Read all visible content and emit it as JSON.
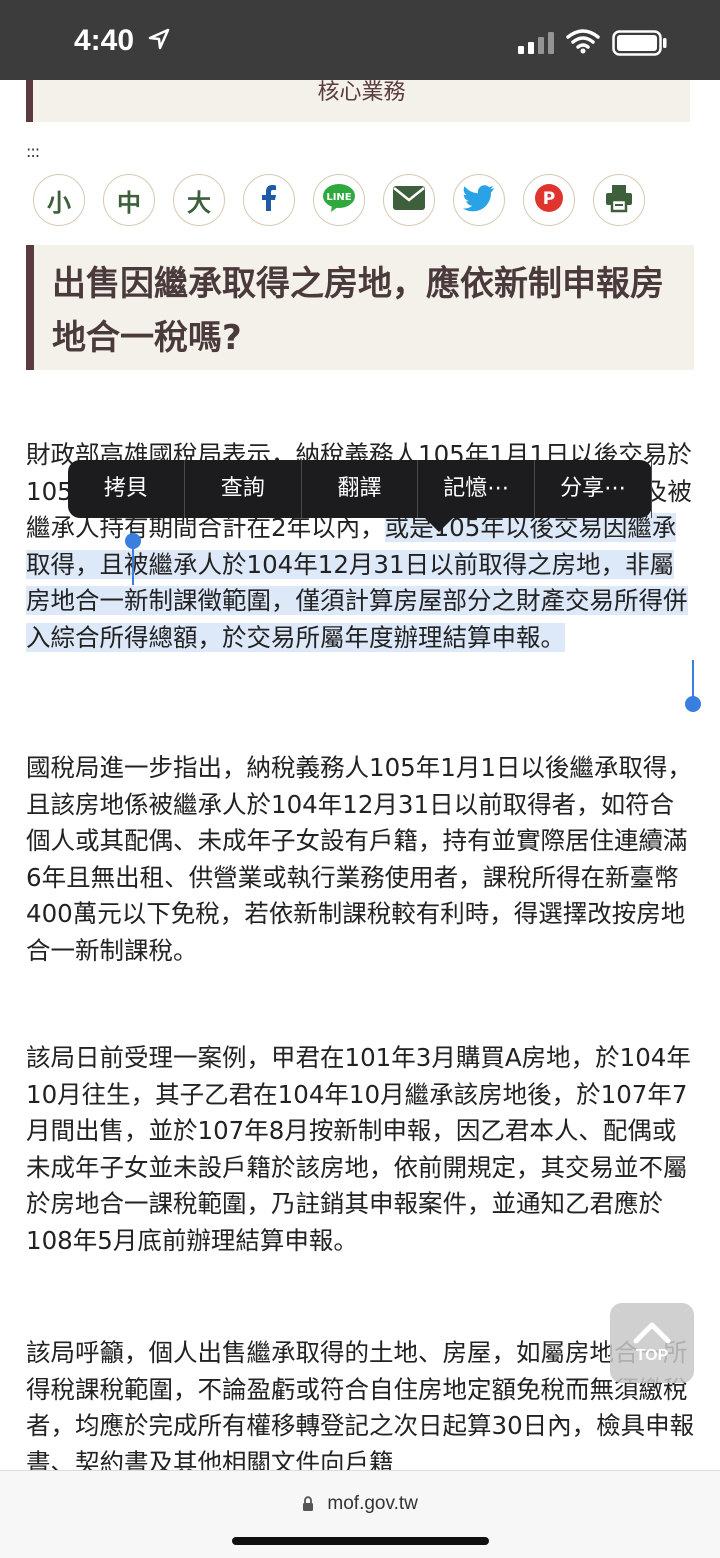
{
  "status_bar": {
    "time": "4:40"
  },
  "top_box": {
    "label": "核心業務"
  },
  "toolbar_dots": ":::",
  "share_buttons": [
    {
      "label": "小",
      "icon": "font-small-icon"
    },
    {
      "label": "中",
      "icon": "font-medium-icon"
    },
    {
      "label": "大",
      "icon": "font-large-icon"
    },
    {
      "label": "",
      "icon": "facebook-icon"
    },
    {
      "label": "",
      "icon": "line-icon"
    },
    {
      "label": "",
      "icon": "email-icon"
    },
    {
      "label": "",
      "icon": "twitter-icon"
    },
    {
      "label": "",
      "icon": "plurk-icon"
    },
    {
      "label": "",
      "icon": "print-icon"
    }
  ],
  "article": {
    "title": "出售因繼承取得之房地，應依新制申報房地合一稅嗎?",
    "p1_before": "財政部高雄國稅局表示，納稅義務人105年1月1日以後交易於105年1月1日以後繼承取得之房屋、土地，且納稅義務人及被繼承人持有期間合計在2年以內，",
    "p1_selected": "或是105年以後交易因繼承取得，且被繼承人於104年12月31日以前取得之房地，非屬房地合一新制課徵範圍，僅須計算房屋部分之財產交易所得併入綜合所得總額，於交易所屬年度辦理結算申報。",
    "p2": "國稅局進一步指出，納稅義務人105年1月1日以後繼承取得，且該房地係被繼承人於104年12月31日以前取得者，如符合個人或其配偶、未成年子女設有戶籍，持有並實際居住連續滿6年且無出租、供營業或執行業務使用者，課稅所得在新臺幣400萬元以下免稅，若依新制課稅較有利時，得選擇改按房地合一新制課稅。",
    "p3": "該局日前受理一案例，甲君在101年3月購買A房地，於104年10月往生，其子乙君在104年10月繼承該房地後，於107年7月間出售，並於107年8月按新制申報，因乙君本人、配偶或未成年子女並未設戶籍於該房地，依前開規定，其交易並不屬於房地合一課稅範圍，乃註銷其申報案件，並通知乙君應於108年5月底前辦理結算申報。",
    "p4": "該局呼籲，個人出售繼承取得的土地、房屋，如屬房地合一所得稅課稅範圍，不論盈虧或符合自住房地定額免稅而無須繳稅者，均應於完成所有權移轉登記之次日起算30日內，檢具申報書、契約書及其他相關文件向戶籍"
  },
  "context_menu": {
    "items": [
      "拷貝",
      "查詢",
      "翻譯",
      "記憶⋯",
      "分享⋯"
    ]
  },
  "scroll_top": {
    "label": "TOP"
  },
  "browser": {
    "url": "mof.gov.tw"
  }
}
